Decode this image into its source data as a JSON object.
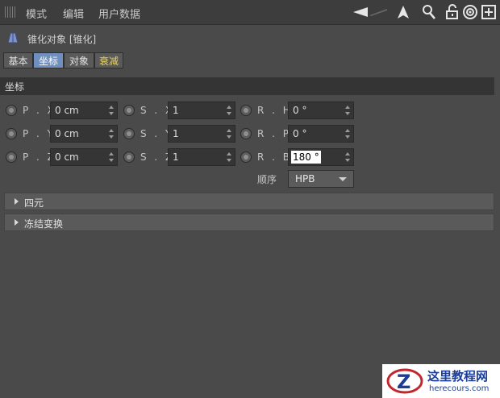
{
  "menu": {
    "items": [
      "模式",
      "编辑",
      "用户数据"
    ]
  },
  "toolbar": {
    "icons": [
      "arrow-left-icon",
      "arrow-up-icon",
      "search-icon",
      "unlock-icon",
      "target-icon",
      "add-panel-icon"
    ]
  },
  "object": {
    "title": "锥化对象 [锥化]",
    "icon": "taper-deformer-icon"
  },
  "tabs": [
    {
      "label": "基本",
      "active": false
    },
    {
      "label": "坐标",
      "active": true
    },
    {
      "label": "对象",
      "active": false
    },
    {
      "label": "衰减",
      "active": false
    }
  ],
  "section": {
    "title": "坐标"
  },
  "coords": {
    "position": [
      {
        "label": "P . X",
        "value": "0 cm"
      },
      {
        "label": "P . Y",
        "value": "0 cm"
      },
      {
        "label": "P . Z",
        "value": "0 cm"
      }
    ],
    "scale": [
      {
        "label": "S . X",
        "value": "1"
      },
      {
        "label": "S . Y",
        "value": "1"
      },
      {
        "label": "S . Z",
        "value": "1"
      }
    ],
    "rotation": [
      {
        "label": "R . H",
        "value": "0 °"
      },
      {
        "label": "R . P",
        "value": "0 °"
      },
      {
        "label": "R . B",
        "value": "180 °"
      }
    ]
  },
  "order": {
    "label": "顺序",
    "value": "HPB"
  },
  "groups": [
    {
      "label": "四元"
    },
    {
      "label": "冻结变换"
    }
  ],
  "watermark": {
    "line1": "这里教程网",
    "line2": "herecours.com"
  },
  "colors": {
    "active_tab": "#6f8fbf",
    "panel_bg": "#4a4a4a",
    "yellow_tab": "#e8d36a"
  }
}
